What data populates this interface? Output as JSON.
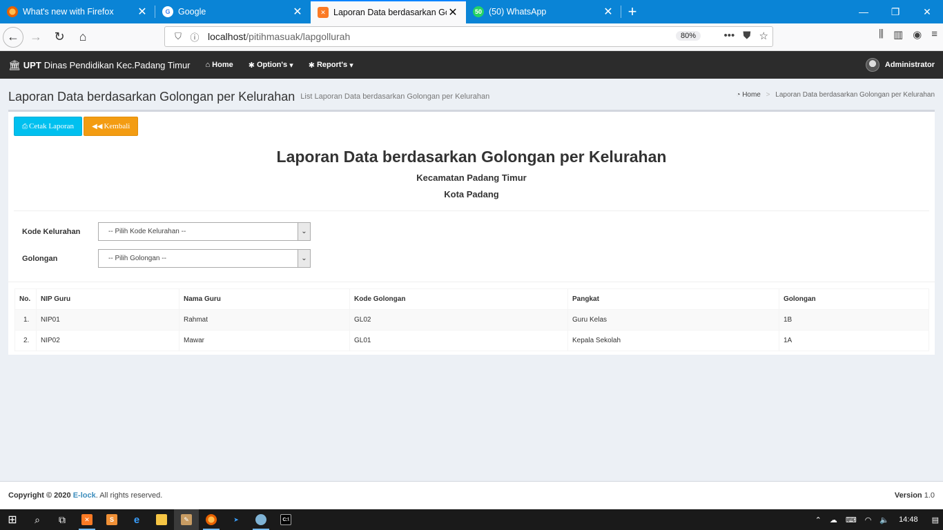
{
  "browser": {
    "tabs": [
      {
        "title": "What's new with Firefox",
        "icon": "firefox-icon",
        "active": false
      },
      {
        "title": "Google",
        "icon": "google-icon",
        "active": false
      },
      {
        "title": "Laporan Data berdasarkan Golc",
        "icon": "xampp-icon",
        "active": true
      },
      {
        "title": "(50) WhatsApp",
        "icon": "whatsapp-icon",
        "active": false
      }
    ],
    "url_host": "localhost",
    "url_path": "/pitihmasuak/lapgollurah",
    "zoom": "80%"
  },
  "app": {
    "brand_bold": "UPT",
    "brand_rest": "Dinas Pendidikan Kec.Padang Timur",
    "menu": {
      "home": "Home",
      "options": "Option's",
      "reports": "Report's"
    },
    "user": "Administrator"
  },
  "page": {
    "title": "Laporan Data berdasarkan Golongan per Kelurahan",
    "subtitle": "List Laporan Data berdasarkan Golongan per Kelurahan",
    "breadcrumb_home": "Home",
    "breadcrumb_current": "Laporan Data berdasarkan Golongan per Kelurahan"
  },
  "report": {
    "print_label": "Cetak Laporan",
    "back_label": "Kembali",
    "heading": "Laporan Data berdasarkan Golongan per Kelurahan",
    "sub1": "Kecamatan Padang Timur",
    "sub2": "Kota Padang",
    "kelurahan_label": "Kode Kelurahan",
    "kelurahan_value": "-- Pilih Kode Kelurahan --",
    "golongan_label": "Golongan",
    "golongan_value": "-- Pilih Golongan --",
    "columns": [
      "No.",
      "NIP Guru",
      "Nama Guru",
      "Kode Golongan",
      "Pangkat",
      "Golongan"
    ],
    "rows": [
      [
        "1.",
        "NIP01",
        "Rahmat",
        "GL02",
        "Guru Kelas",
        "1B"
      ],
      [
        "2.",
        "NIP02",
        "Mawar",
        "GL01",
        "Kepala Sekolah",
        "1A"
      ]
    ]
  },
  "footer": {
    "copyright": "Copyright © 2020",
    "brand": "E-lock",
    "rights": ". All rights reserved.",
    "version_label": "Version",
    "version": "1.0"
  },
  "taskbar": {
    "time": "14:48"
  }
}
